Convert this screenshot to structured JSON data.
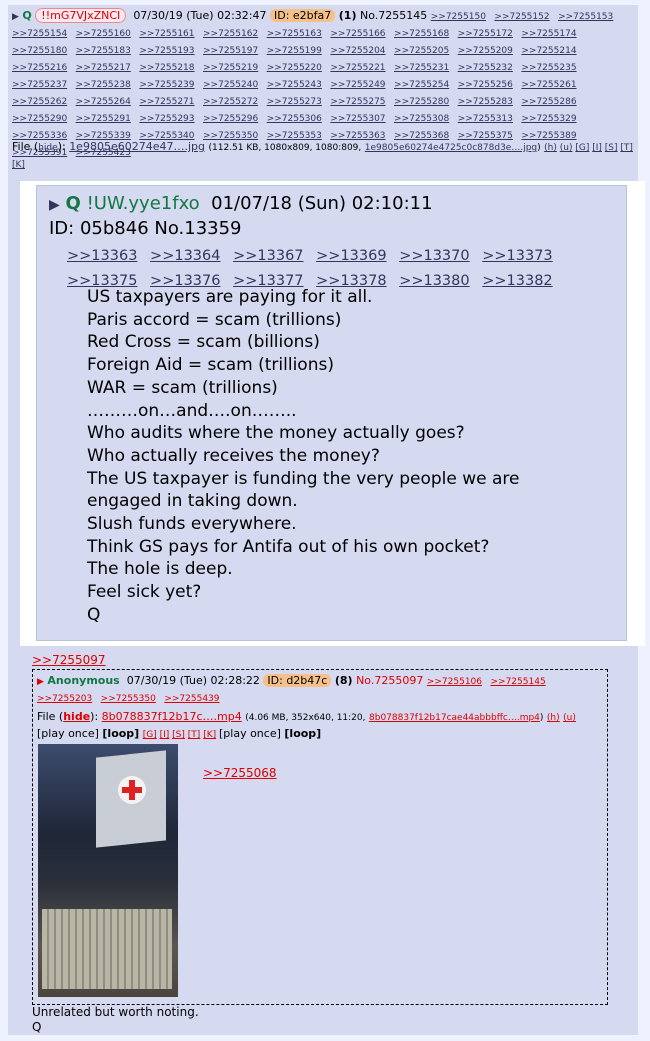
{
  "op": {
    "arrow": "▶",
    "name": "Q",
    "tripcode": "!!mG7VJxZNCI",
    "datetime": "07/30/19 (Tue) 02:32:47",
    "id_label": "ID: e2bfa7",
    "reply_count": "(1)",
    "post_no": "No.7255145",
    "backlinks": [
      ">>7255150",
      ">>7255152",
      ">>7255153",
      ">>7255154",
      ">>7255160",
      ">>7255161",
      ">>7255162",
      ">>7255163",
      ">>7255166",
      ">>7255168",
      ">>7255172",
      ">>7255174",
      ">>7255180",
      ">>7255183",
      ">>7255193",
      ">>7255197",
      ">>7255199",
      ">>7255204",
      ">>7255205",
      ">>7255209",
      ">>7255214",
      ">>7255216",
      ">>7255217",
      ">>7255218",
      ">>7255219",
      ">>7255220",
      ">>7255221",
      ">>7255231",
      ">>7255232",
      ">>7255235",
      ">>7255237",
      ">>7255238",
      ">>7255239",
      ">>7255240",
      ">>7255243",
      ">>7255249",
      ">>7255254",
      ">>7255256",
      ">>7255261",
      ">>7255262",
      ">>7255264",
      ">>7255271",
      ">>7255272",
      ">>7255273",
      ">>7255275",
      ">>7255280",
      ">>7255283",
      ">>7255286",
      ">>7255290",
      ">>7255291",
      ">>7255293",
      ">>7255296",
      ">>7255306",
      ">>7255307",
      ">>7255308",
      ">>7255313",
      ">>7255329",
      ">>7255336",
      ">>7255339",
      ">>7255340",
      ">>7255350",
      ">>7255353",
      ">>7255363",
      ">>7255368",
      ">>7255375",
      ">>7255389",
      ">>7255391",
      ">>7255423"
    ],
    "file_prefix": "File",
    "file_hide": "hide",
    "file_name": "1e9805e60274e47….jpg",
    "file_meta": "(112.51 KB, 1080x809, 1080:809,",
    "file_full": "1e9805e60274e4725c0c878d3e….jpg",
    "file_tools": [
      "(h)",
      "(u)",
      "[G]",
      "[I]",
      "[S]",
      "[T]",
      "[K]"
    ]
  },
  "image_post": {
    "arrow": "▶",
    "name": "Q",
    "trip": "!UW.yye1fxo",
    "datetime": "01/07/18 (Sun) 02:10:11",
    "id_no": "ID: 05b846 No.13359",
    "backlinks": [
      ">>13363",
      ">>13364",
      ">>13367",
      ">>13369",
      ">>13370",
      ">>13373",
      ">>13375",
      ">>13376",
      ">>13377",
      ">>13378",
      ">>13380",
      ">>13382"
    ],
    "lines": [
      "US taxpayers are paying for it all.",
      "Paris accord = scam (trillions)",
      "Red Cross = scam (billions)",
      "Foreign Aid = scam (trillions)",
      "WAR = scam (trillions)",
      "………on…and….on……..",
      "Who audits where the money actually goes?",
      "Who actually receives the money?",
      "The US taxpayer is funding the very people we are",
      "engaged in taking down.",
      "Slush funds everywhere.",
      "Think GS pays for Antifa out of his own pocket?",
      "The hole is deep.",
      "Feel sick yet?",
      "Q"
    ]
  },
  "quote_link": ">>7255097",
  "reply": {
    "arrow": "▶",
    "name": "Anonymous",
    "datetime": "07/30/19 (Tue) 02:28:22",
    "id_label": "ID: d2b47c",
    "count": "(8)",
    "post_no": "No.7255097",
    "backlinks": [
      ">>7255106",
      ">>7255145",
      ">>7255203",
      ">>7255350",
      ">>7255439"
    ],
    "file_prefix": "File",
    "file_hide": "hide",
    "file_name": "8b078837f12b17c….mp4",
    "file_meta": "(4.06 MB, 352x640, 11:20,",
    "file_full": "8b078837f12b17cae44abbbffc….mp4",
    "file_h": "(h)",
    "file_u": "(u)",
    "play_once": "[play once]",
    "loop": "[loop]",
    "tools": [
      "[G]",
      "[I]",
      "[S]",
      "[T]",
      "[K]"
    ],
    "body_link": ">>7255068"
  },
  "footer_lines": [
    "Unrelated but worth noting.",
    "Q"
  ]
}
